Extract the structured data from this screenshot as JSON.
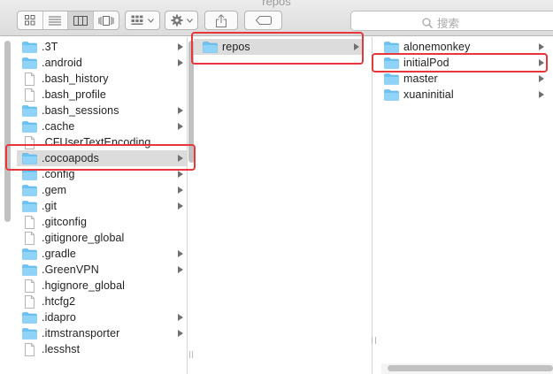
{
  "window": {
    "title": "repos"
  },
  "toolbar": {
    "view_modes": [
      "icon-view-icon",
      "list-view-icon",
      "column-view-icon",
      "coverflow-view-icon"
    ],
    "active_view": 2,
    "arrange_icon": "grid-arrange-icon",
    "action_icon": "gear-icon",
    "share_icon": "share-icon",
    "tag_icon": "tag-icon",
    "search_placeholder": "搜索"
  },
  "columns": [
    {
      "items": [
        {
          "label": ".3T",
          "type": "folder",
          "has_children": true
        },
        {
          "label": ".android",
          "type": "folder",
          "has_children": true
        },
        {
          "label": ".bash_history",
          "type": "file",
          "has_children": false
        },
        {
          "label": ".bash_profile",
          "type": "file",
          "has_children": false
        },
        {
          "label": ".bash_sessions",
          "type": "folder",
          "has_children": true
        },
        {
          "label": ".cache",
          "type": "folder",
          "has_children": true
        },
        {
          "label": ".CFUserTextEncoding",
          "type": "file",
          "has_children": false
        },
        {
          "label": ".cocoapods",
          "type": "folder",
          "has_children": true,
          "selected": true,
          "highlighted": true
        },
        {
          "label": ".config",
          "type": "folder",
          "has_children": true
        },
        {
          "label": ".gem",
          "type": "folder",
          "has_children": true
        },
        {
          "label": ".git",
          "type": "folder",
          "has_children": true
        },
        {
          "label": ".gitconfig",
          "type": "file",
          "has_children": false
        },
        {
          "label": ".gitignore_global",
          "type": "file",
          "has_children": false
        },
        {
          "label": ".gradle",
          "type": "folder",
          "has_children": true
        },
        {
          "label": ".GreenVPN",
          "type": "folder",
          "has_children": true
        },
        {
          "label": ".hgignore_global",
          "type": "file",
          "has_children": false
        },
        {
          "label": ".htcfg2",
          "type": "file",
          "has_children": false
        },
        {
          "label": ".idapro",
          "type": "folder",
          "has_children": true
        },
        {
          "label": ".itmstransporter",
          "type": "folder",
          "has_children": true
        },
        {
          "label": ".lesshst",
          "type": "file",
          "has_children": false
        }
      ]
    },
    {
      "items": [
        {
          "label": "repos",
          "type": "folder",
          "has_children": true,
          "selected": true,
          "highlighted": true
        }
      ]
    },
    {
      "items": [
        {
          "label": "alonemonkey",
          "type": "folder",
          "has_children": true
        },
        {
          "label": "initialPod",
          "type": "folder",
          "has_children": true,
          "highlighted": true
        },
        {
          "label": "master",
          "type": "folder",
          "has_children": true
        },
        {
          "label": "xuaninitial",
          "type": "folder",
          "has_children": true
        }
      ]
    }
  ],
  "colors": {
    "highlight": "#e8363b",
    "folder": "#6cc3f5",
    "selection": "#dcdcdc"
  }
}
